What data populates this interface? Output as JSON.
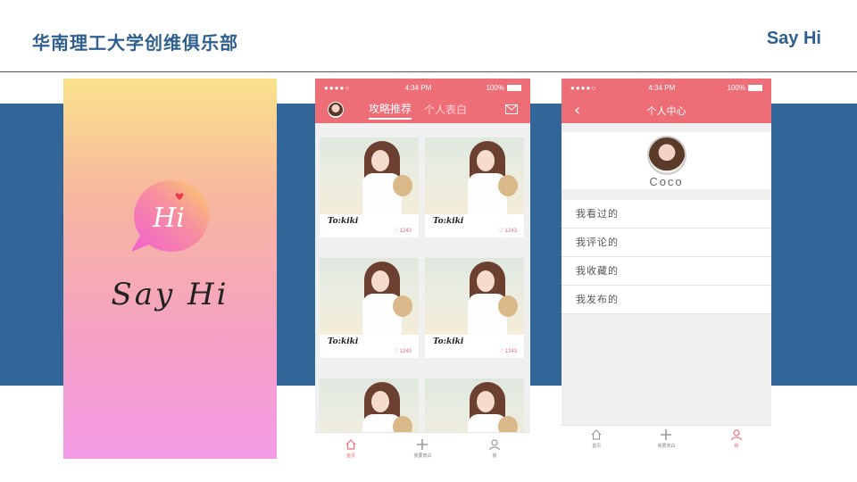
{
  "header": {
    "title": "华南理工大学创维俱乐部",
    "right": "Say Hi"
  },
  "splash": {
    "logo_text": "Hi",
    "text": "Say Hi"
  },
  "status_bar": {
    "signal": "●●●●○",
    "time": "4:34 PM",
    "battery": "100%"
  },
  "feed": {
    "tabs": [
      "攻略推荐",
      "个人表白"
    ],
    "cards": [
      {
        "to": "To:kiki",
        "likes": "1243"
      },
      {
        "to": "To:kiki",
        "likes": "1243"
      },
      {
        "to": "To:kiki",
        "likes": "1243"
      },
      {
        "to": "To:kiki",
        "likes": "1243"
      },
      {
        "to": "",
        "likes": ""
      },
      {
        "to": "",
        "likes": ""
      }
    ],
    "tabbar": [
      "首页",
      "我要表白",
      "我"
    ]
  },
  "profile": {
    "title": "个人中心",
    "username": "Coco",
    "menu": [
      "我看过的",
      "我评论的",
      "我收藏的",
      "我发布的"
    ],
    "tabbar": [
      "首页",
      "我要表白",
      "我"
    ]
  },
  "colors": {
    "accent": "#ee6e78",
    "brand_blue": "#326698",
    "header_text": "#2e5f8e"
  }
}
